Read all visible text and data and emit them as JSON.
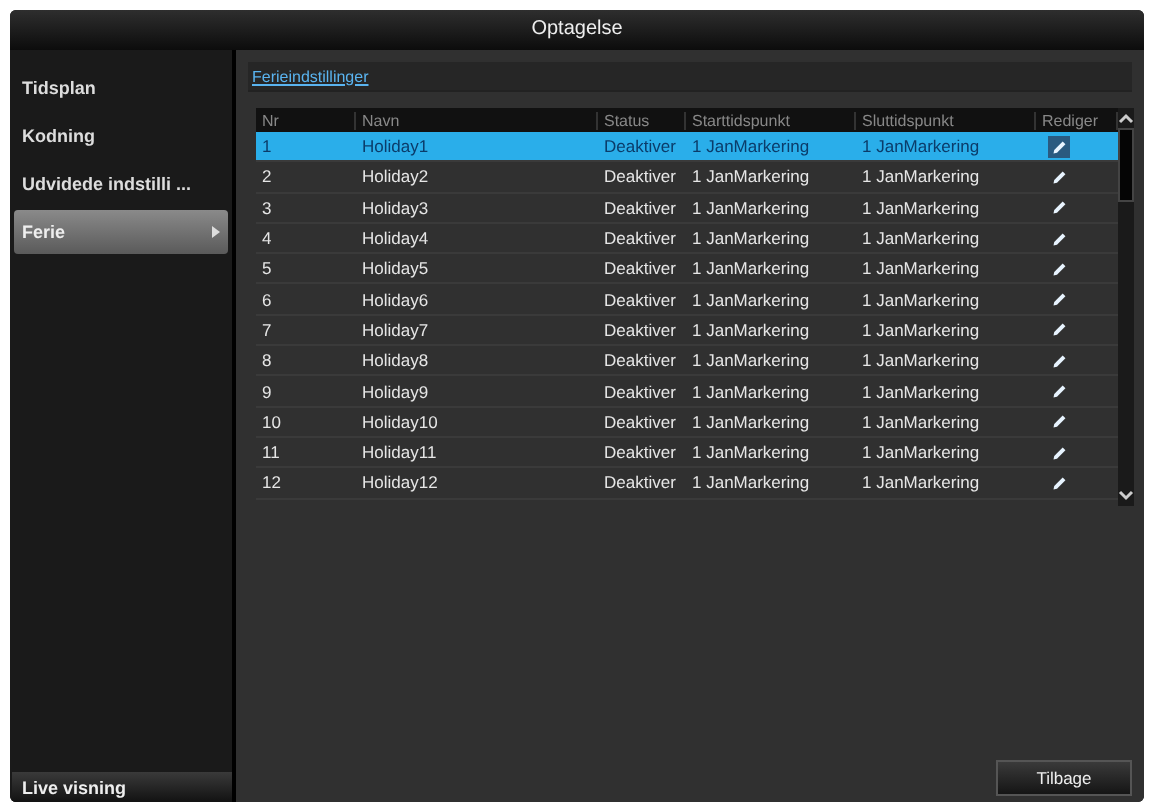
{
  "window": {
    "title": "Optagelse"
  },
  "sidebar": {
    "items": [
      {
        "label": "Tidsplan",
        "selected": false
      },
      {
        "label": "Kodning",
        "selected": false
      },
      {
        "label": "Udvidede indstilli ...",
        "selected": false
      },
      {
        "label": "Ferie",
        "selected": true
      }
    ],
    "footer": "Live visning"
  },
  "tab": {
    "label": "Ferieindstillinger"
  },
  "table": {
    "columns": [
      "Nr",
      "Navn",
      "Status",
      "Starttidspunkt",
      "Sluttidspunkt",
      "Rediger"
    ],
    "rows": [
      {
        "nr": "1",
        "name": "Holiday1",
        "status": "Deaktiver",
        "start": "1 JanMarkering",
        "end": "1 JanMarkering",
        "selected": true
      },
      {
        "nr": "2",
        "name": "Holiday2",
        "status": "Deaktiver",
        "start": "1 JanMarkering",
        "end": "1 JanMarkering",
        "selected": false
      },
      {
        "nr": "3",
        "name": "Holiday3",
        "status": "Deaktiver",
        "start": "1 JanMarkering",
        "end": "1 JanMarkering",
        "selected": false
      },
      {
        "nr": "4",
        "name": "Holiday4",
        "status": "Deaktiver",
        "start": "1 JanMarkering",
        "end": "1 JanMarkering",
        "selected": false
      },
      {
        "nr": "5",
        "name": "Holiday5",
        "status": "Deaktiver",
        "start": "1 JanMarkering",
        "end": "1 JanMarkering",
        "selected": false
      },
      {
        "nr": "6",
        "name": "Holiday6",
        "status": "Deaktiver",
        "start": "1 JanMarkering",
        "end": "1 JanMarkering",
        "selected": false
      },
      {
        "nr": "7",
        "name": "Holiday7",
        "status": "Deaktiver",
        "start": "1 JanMarkering",
        "end": "1 JanMarkering",
        "selected": false
      },
      {
        "nr": "8",
        "name": "Holiday8",
        "status": "Deaktiver",
        "start": "1 JanMarkering",
        "end": "1 JanMarkering",
        "selected": false
      },
      {
        "nr": "9",
        "name": "Holiday9",
        "status": "Deaktiver",
        "start": "1 JanMarkering",
        "end": "1 JanMarkering",
        "selected": false
      },
      {
        "nr": "10",
        "name": "Holiday10",
        "status": "Deaktiver",
        "start": "1 JanMarkering",
        "end": "1 JanMarkering",
        "selected": false
      },
      {
        "nr": "11",
        "name": "Holiday11",
        "status": "Deaktiver",
        "start": "1 JanMarkering",
        "end": "1 JanMarkering",
        "selected": false
      },
      {
        "nr": "12",
        "name": "Holiday12",
        "status": "Deaktiver",
        "start": "1 JanMarkering",
        "end": "1 JanMarkering",
        "selected": false
      }
    ]
  },
  "buttons": [
    "Tilbage"
  ]
}
